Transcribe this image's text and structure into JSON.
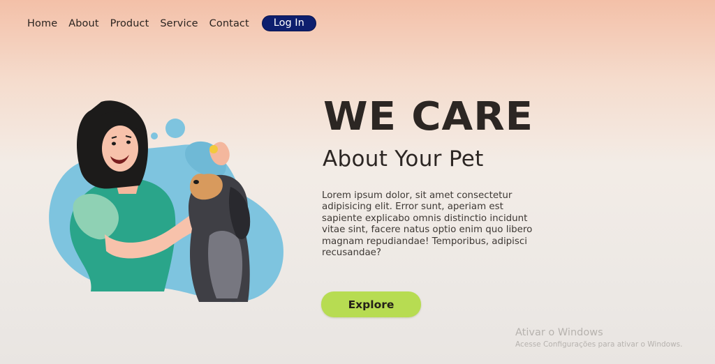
{
  "nav": {
    "items": [
      "Home",
      "About",
      "Product",
      "Service",
      "Contact"
    ],
    "login_label": "Log In"
  },
  "hero": {
    "headline": "WE CARE",
    "subheadline": "About Your Pet",
    "body": "Lorem ipsum dolor, sit amet consectetur adipisicing elit. Error sunt, aperiam est sapiente explicabo omnis distinctio incidunt vitae sint, facere natus optio enim quo libero magnam repudiandae! Temporibus, adipisci recusandae?",
    "cta_label": "Explore"
  },
  "watermark": {
    "title": "Ativar o Windows",
    "subtitle": "Acesse Configurações para ativar o Windows."
  },
  "colors": {
    "accent_navy": "#0d1f6e",
    "cta_green": "#b7dc52",
    "blob_blue": "#7ec4df",
    "shirt_green": "#2aa58a"
  },
  "illustration": {
    "icon": "woman-with-dog-illustration"
  }
}
